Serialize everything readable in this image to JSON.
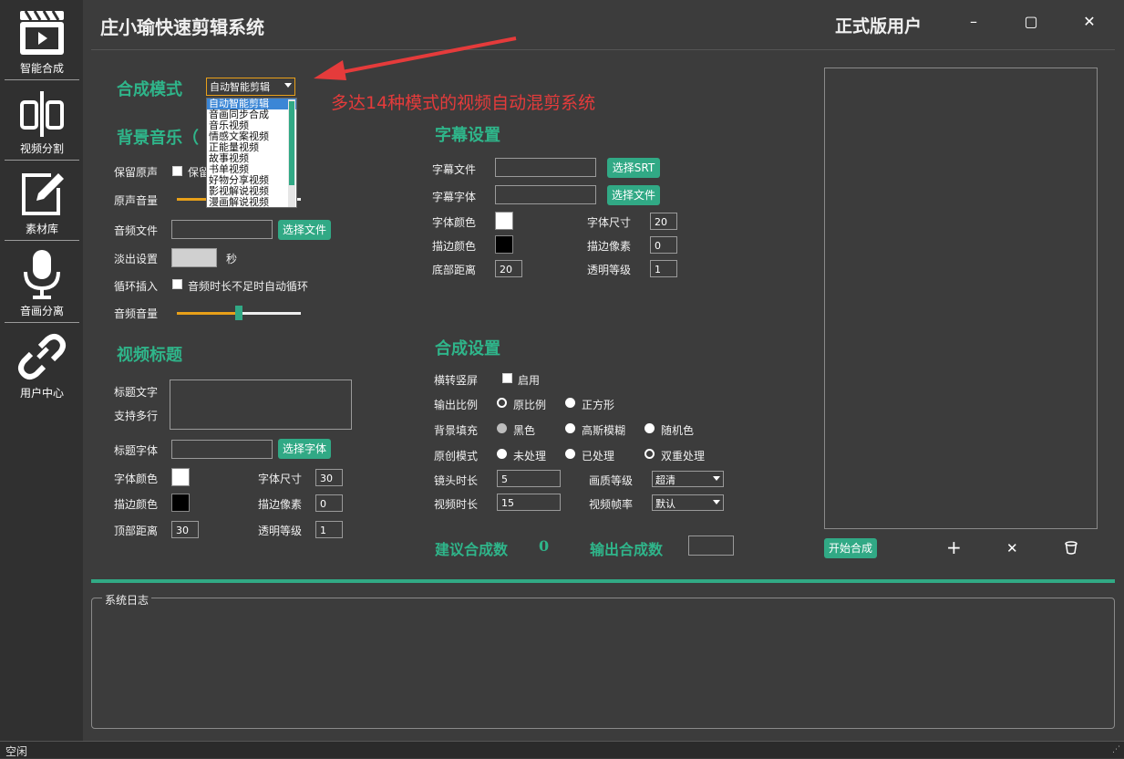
{
  "app": {
    "title": "庄小瑜快速剪辑系统",
    "version_label": "正式版用户",
    "minimize": "–",
    "maximize": "▢",
    "close": "✕"
  },
  "sidebar": {
    "items": [
      {
        "label": "智能合成",
        "icon": "clapperboard-icon"
      },
      {
        "label": "视频分割",
        "icon": "split-icon"
      },
      {
        "label": "素材库",
        "icon": "edit-icon"
      },
      {
        "label": "音画分离",
        "icon": "microphone-icon"
      },
      {
        "label": "用户中心",
        "icon": "link-icon"
      }
    ]
  },
  "mode": {
    "label": "合成模式",
    "selected": "自动智能剪辑",
    "annotation": "多达14种模式的视频自动混剪系统",
    "options": [
      "自动智能剪辑",
      "音画同步合成",
      "音乐视频",
      "情感文案视频",
      "正能量视频",
      "故事视频",
      "书单视频",
      "好物分享视频",
      "影视解说视频",
      "漫画解说视频"
    ]
  },
  "bgm": {
    "title": "背景音乐（",
    "keep_original_label": "保留原声",
    "keep_original_check": "保留",
    "original_volume_label": "原声音量",
    "audio_file_label": "音频文件",
    "audio_file_button": "选择文件",
    "fade_label": "淡出设置",
    "fade_unit": "秒",
    "loop_label": "循环插入",
    "loop_check": "音频时长不足时自动循环",
    "audio_volume_label": "音频音量",
    "audio_volume": 0.5
  },
  "video_title": {
    "title": "视频标题",
    "text_label_1": "标题文字",
    "text_label_2": "支持多行",
    "font_label": "标题字体",
    "font_button": "选择字体",
    "font_color_label": "字体颜色",
    "font_size_label": "字体尺寸",
    "font_size": "30",
    "stroke_color_label": "描边颜色",
    "stroke_px_label": "描边像素",
    "stroke_px": "0",
    "top_margin_label": "顶部距离",
    "top_margin": "30",
    "opacity_label": "透明等级",
    "opacity": "1"
  },
  "subtitle": {
    "title": "字幕设置",
    "file_label": "字幕文件",
    "file_button": "选择SRT",
    "font_label": "字幕字体",
    "font_button": "选择文件",
    "font_color_label": "字体颜色",
    "font_size_label": "字体尺寸",
    "font_size": "20",
    "stroke_color_label": "描边颜色",
    "stroke_px_label": "描边像素",
    "stroke_px": "0",
    "bottom_margin_label": "底部距离",
    "bottom_margin": "20",
    "opacity_label": "透明等级",
    "opacity": "1"
  },
  "compose": {
    "title": "合成设置",
    "rotate_label": "横转竖屏",
    "rotate_check": "启用",
    "ratio_label": "输出比例",
    "ratio_original": "原比例",
    "ratio_square": "正方形",
    "fill_label": "背景填充",
    "fill_black": "黑色",
    "fill_blur": "高斯模糊",
    "fill_random": "随机色",
    "orig_label": "原创模式",
    "orig_none": "未处理",
    "orig_done": "已处理",
    "orig_double": "双重处理",
    "shot_len_label": "镜头时长",
    "shot_len": "5",
    "quality_label": "画质等级",
    "quality": "超清",
    "video_len_label": "视频时长",
    "video_len": "15",
    "fps_label": "视频帧率",
    "fps": "默认",
    "suggest_label": "建议合成数",
    "suggest_value": "0",
    "output_label": "输出合成数"
  },
  "actions": {
    "start": "开始合成",
    "add": "+",
    "remove": "✕",
    "trash": "🗑"
  },
  "log": {
    "title": "系统日志"
  },
  "status": {
    "text": "空闲"
  },
  "colors": {
    "accent": "#31a985",
    "slider": "#e8a019",
    "annotation": "#e53b3b"
  }
}
